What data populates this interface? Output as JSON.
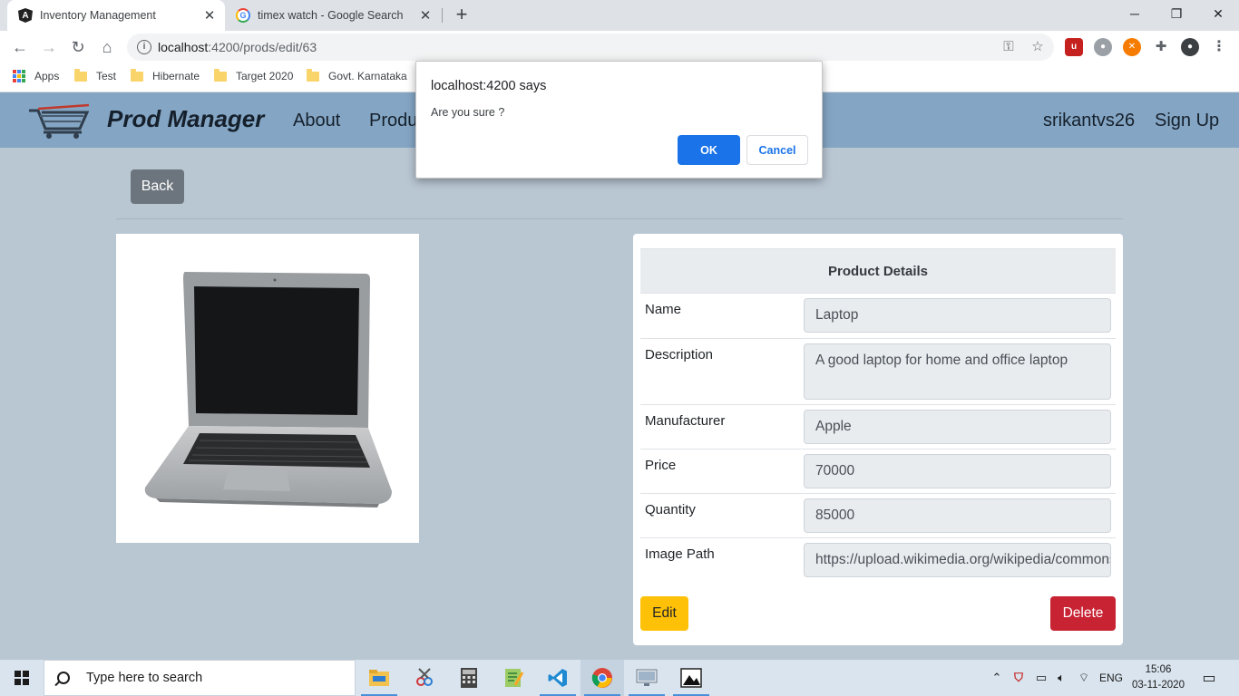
{
  "browser": {
    "tabs": [
      {
        "title": "Inventory Management",
        "active": true,
        "favicon": "angular-icon"
      },
      {
        "title": "timex watch - Google Search",
        "active": false,
        "favicon": "google-icon"
      }
    ],
    "new_tab": "+",
    "window_controls": {
      "minimize": "─",
      "restore": "❐",
      "close": "✕"
    },
    "url": {
      "host": "localhost",
      "rest": ":4200/prods/edit/63"
    },
    "bookmarks": [
      {
        "label": "Apps",
        "icon": "apps-grid-icon"
      },
      {
        "label": "Test",
        "icon": "folder-icon"
      },
      {
        "label": "Hibernate",
        "icon": "folder-icon"
      },
      {
        "label": "Target 2020",
        "icon": "folder-icon"
      },
      {
        "label": "Govt. Karnataka",
        "icon": "folder-icon"
      }
    ]
  },
  "app": {
    "brand": "Prod Manager",
    "nav": {
      "about": "About",
      "products": "Products"
    },
    "user": "srikantvs26",
    "signup": "Sign Up"
  },
  "page": {
    "back_label": "Back",
    "card_title": "Product Details",
    "fields": [
      {
        "label": "Name",
        "value": "Laptop"
      },
      {
        "label": "Description",
        "value": "A good laptop for home and office laptop"
      },
      {
        "label": "Manufacturer",
        "value": "Apple"
      },
      {
        "label": "Price",
        "value": "70000"
      },
      {
        "label": "Quantity",
        "value": "85000"
      },
      {
        "label": "Image Path",
        "value": "https://upload.wikimedia.org/wikipedia/commons"
      }
    ],
    "edit_label": "Edit",
    "delete_label": "Delete"
  },
  "dialog": {
    "title": "localhost:4200 says",
    "message": "Are you sure ?",
    "ok": "OK",
    "cancel": "Cancel"
  },
  "taskbar": {
    "search_placeholder": "Type here to search",
    "language": "ENG",
    "time": "15:06",
    "date": "03-11-2020"
  },
  "colors": {
    "navbar": "#84a6c4",
    "page_bg": "#b9c7d3",
    "back_button": "#6c757d",
    "edit_button": "#ffc107",
    "delete_button": "#c82333",
    "dialog_ok": "#1a73e8"
  }
}
